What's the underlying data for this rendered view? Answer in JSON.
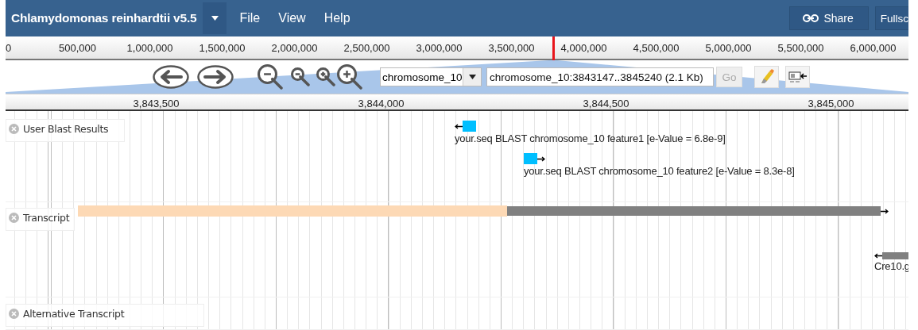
{
  "menubar": {
    "title": "Chlamydomonas reinhardtii v5.5",
    "menus": [
      "File",
      "View",
      "Help"
    ],
    "buttons": [
      {
        "kind": "share",
        "label": "Share"
      },
      {
        "kind": "fullscreen",
        "label": "Fullsc"
      }
    ]
  },
  "overview": {
    "ticks": [
      "0",
      "500,000",
      "1,000,000",
      "1,500,000",
      "2,000,000",
      "2,500,000",
      "3,000,000",
      "3,500,000",
      "4,000,000",
      "4,500,000",
      "5,000,000",
      "5,500,000",
      "6,000,000"
    ]
  },
  "navigation": {
    "reference": {
      "value": "chromosome_10"
    },
    "location": {
      "value": "chromosome_10:3843147..3845240 (2.1 Kb)"
    },
    "go": {
      "label": "Go",
      "disabled": true
    }
  },
  "ruler": {
    "ticks": [
      "3,843,500",
      "3,844,000",
      "3,844,500",
      "3,845,000"
    ]
  },
  "tracks": [
    {
      "label": "User Blast Results",
      "features": [
        {
          "kind": "blast",
          "reverse": true,
          "label": "your.seq BLAST chromosome_10 feature1 [e-Value = 6.8e-9]"
        },
        {
          "kind": "blast",
          "reverse": false,
          "label": "your.seq BLAST chromosome_10 feature2 [e-Value = 8.3e-8]"
        }
      ]
    },
    {
      "label": "Transcript",
      "features": [
        {
          "kind": "gene",
          "reverse": false
        },
        {
          "kind": "gene",
          "reverse": true,
          "label": "Cre10.g"
        }
      ]
    },
    {
      "label": "Alternative Transcript"
    }
  ]
}
